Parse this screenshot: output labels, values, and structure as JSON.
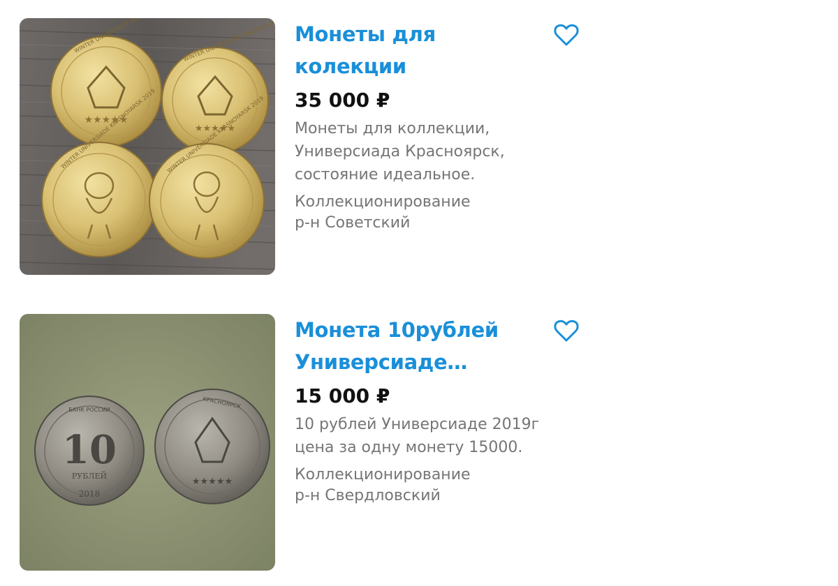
{
  "listings": [
    {
      "title": "Монеты для колекции",
      "price": "35 000 ₽",
      "description": [
        "Монеты для коллекции,",
        "Универсиада Красноярск,",
        "состояние идеальное."
      ],
      "category": "Коллекционирование",
      "district": "р-н Советский",
      "favorite_icon": "heart-outline-icon",
      "photo_coin_inscriptions": [
        "WINTER UNIVERSIADE KRASNOYARSK 2019"
      ]
    },
    {
      "title_lines": [
        "Монета 10рублей",
        "Универсиаде…"
      ],
      "price": "15 000 ₽",
      "description": [
        "10 рублей Универсиаде 2019г",
        "цена за одну монету 15000."
      ],
      "category": "Коллекционирование",
      "district": "р-н Свердловский",
      "favorite_icon": "heart-outline-icon",
      "photo_coin_inscriptions": [
        "10",
        "РУБЛЕЙ",
        "2018",
        "БАНК РОССИИ",
        "КРАСНОЯРСК"
      ]
    }
  ],
  "colors": {
    "title": "#1a8fd9",
    "price": "#111111",
    "secondary_text": "#757575",
    "heart": "#1a8fd9"
  }
}
